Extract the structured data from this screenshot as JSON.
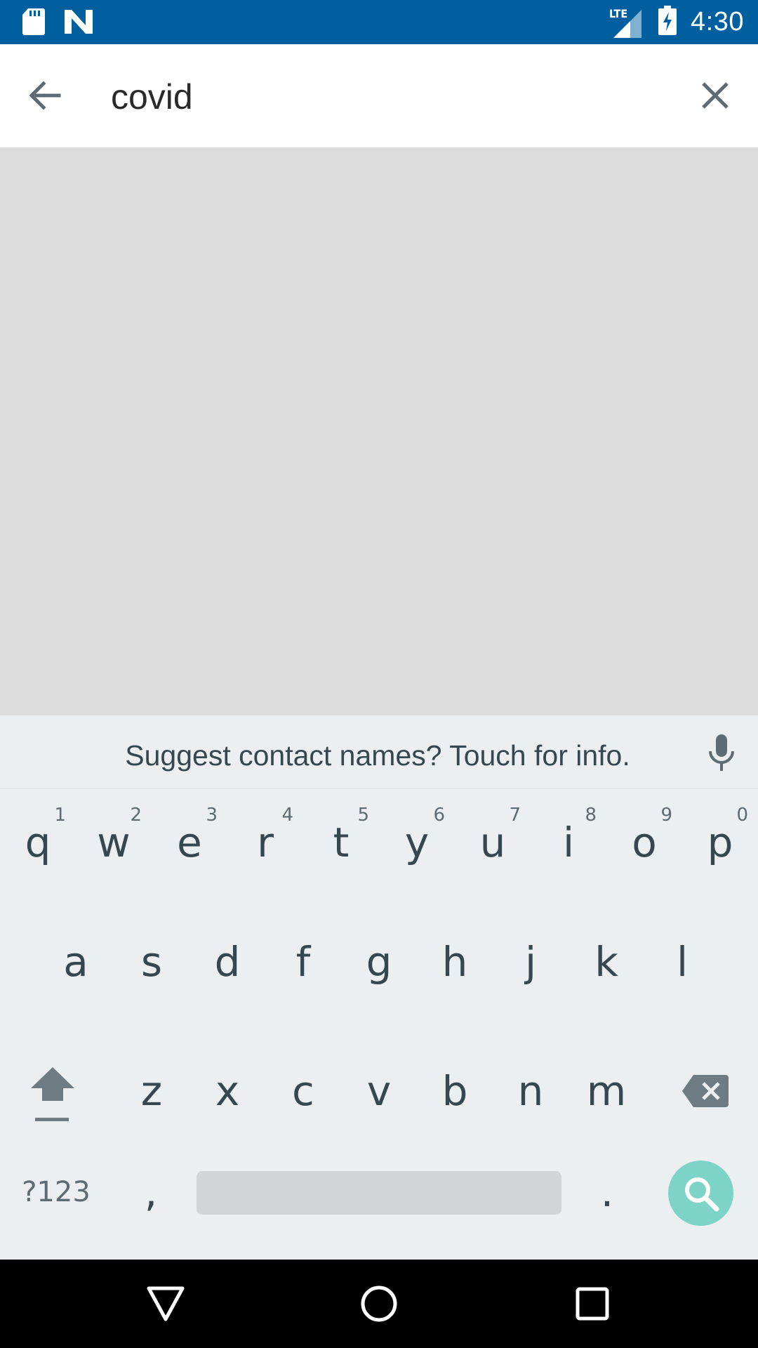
{
  "status_bar": {
    "time": "4:30",
    "network": "LTE",
    "icons": [
      "sd-card-icon",
      "app-notification-icon",
      "signal-icon",
      "battery-charging-icon"
    ],
    "bg_color": "#00609f"
  },
  "search": {
    "query": "covid",
    "back_icon": "back-arrow-icon",
    "clear_icon": "close-icon"
  },
  "keyboard": {
    "suggestion": "Suggest contact names? Touch for info.",
    "row1": [
      {
        "k": "q",
        "h": "1"
      },
      {
        "k": "w",
        "h": "2"
      },
      {
        "k": "e",
        "h": "3"
      },
      {
        "k": "r",
        "h": "4"
      },
      {
        "k": "t",
        "h": "5"
      },
      {
        "k": "y",
        "h": "6"
      },
      {
        "k": "u",
        "h": "7"
      },
      {
        "k": "i",
        "h": "8"
      },
      {
        "k": "o",
        "h": "9"
      },
      {
        "k": "p",
        "h": "0"
      }
    ],
    "row2": [
      "a",
      "s",
      "d",
      "f",
      "g",
      "h",
      "j",
      "k",
      "l"
    ],
    "row3": [
      "z",
      "x",
      "c",
      "v",
      "b",
      "n",
      "m"
    ],
    "symbols_label": "?123",
    "comma": ",",
    "period": ".",
    "accent_color": "#7cd3c6"
  },
  "nav": {
    "icons": [
      "back-triangle-icon",
      "home-circle-icon",
      "recents-square-icon"
    ]
  }
}
